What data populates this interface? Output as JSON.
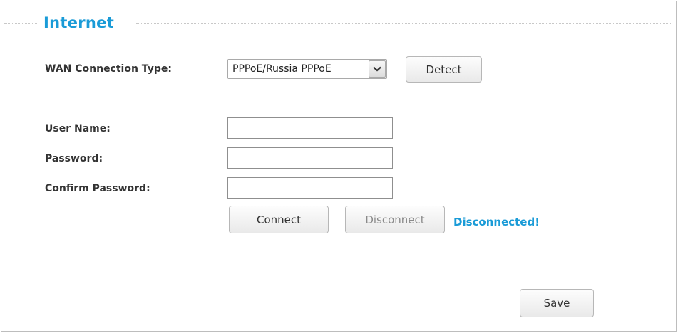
{
  "section": {
    "title": "Internet"
  },
  "wan": {
    "label": "WAN Connection Type:",
    "selected": "PPPoE/Russia PPPoE",
    "detect_label": "Detect"
  },
  "fields": {
    "username_label": "User Name:",
    "username_value": "",
    "password_label": "Password:",
    "password_value": "",
    "confirm_label": "Confirm Password:",
    "confirm_value": ""
  },
  "actions": {
    "connect_label": "Connect",
    "disconnect_label": "Disconnect",
    "status_text": "Disconnected!",
    "save_label": "Save"
  },
  "colors": {
    "accent": "#1a9bd7",
    "label_text": "#333333",
    "border": "#bdbdbd"
  },
  "icons": {
    "dropdown": "chevron-down-icon"
  }
}
